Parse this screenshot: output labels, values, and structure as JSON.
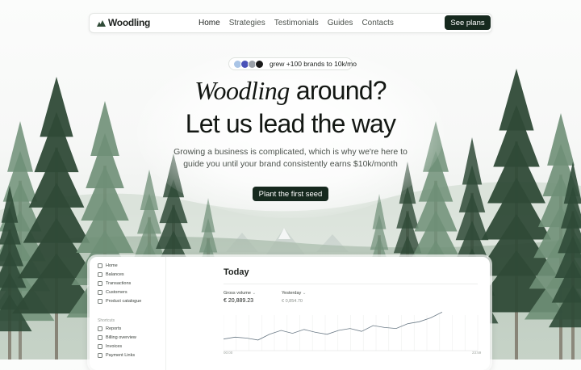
{
  "nav": {
    "brand": "Woodling",
    "links": [
      "Home",
      "Strategies",
      "Testimonials",
      "Guides",
      "Contacts"
    ],
    "cta": "See plans"
  },
  "hero": {
    "badge_text": "grew +100 brands to 10k/mo",
    "title_italic": "Woodling",
    "title_rest": "around?",
    "title_line2": "Let us lead the way",
    "subtitle_line1": "Growing a business is complicated, which is why we're here to",
    "subtitle_line2": "guide you until your brand consistently earns $10k/month",
    "cta": "Plant the first seed"
  },
  "dashboard": {
    "sidebar": [
      "Home",
      "Balances",
      "Transactions",
      "Customers",
      "Product catalogue"
    ],
    "shortcuts_label": "Shortcuts",
    "shortcuts": [
      "Reports",
      "Billing overview",
      "Invoices",
      "Payment Links"
    ],
    "title": "Today",
    "gross_label": "Gross volume",
    "gross_value": "€ 20,889.23",
    "yesterday_label": "Yesterday",
    "yesterday_value": "€ 0,854.70",
    "time_start": "00:00",
    "time_end": "23:59",
    "chart_values": [
      12,
      14,
      13,
      11,
      17,
      21,
      18,
      22,
      19,
      17,
      21,
      23,
      20,
      26,
      24,
      23,
      28,
      30,
      34,
      40
    ]
  },
  "colors": {
    "accent": "#16291e",
    "tree_dark": "#2f4a37",
    "tree_light": "#6f8f77"
  }
}
